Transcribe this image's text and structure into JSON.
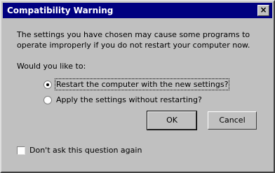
{
  "dialog": {
    "title": "Compatibility Warning",
    "close_label": "×",
    "message": "The settings you have chosen may cause some programs to operate improperly if you do not restart your computer now.",
    "prompt": "Would you like to:",
    "options": [
      {
        "label": "Restart the computer with the new settings?",
        "checked": true
      },
      {
        "label": "Apply the settings without restarting?",
        "checked": false
      }
    ],
    "ok_label": "OK",
    "cancel_label": "Cancel",
    "dont_ask_label": "Don't ask this question again"
  }
}
